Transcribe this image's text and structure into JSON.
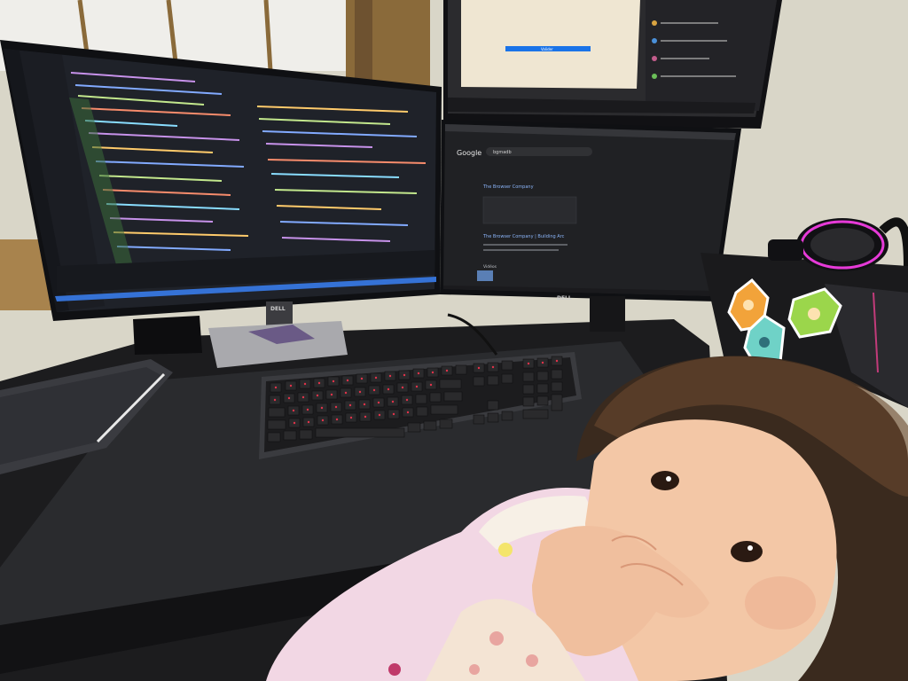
{
  "scene": {
    "colors": {
      "wall": "#d9d6c8",
      "desk": "#1c1c1e",
      "deskmat": "#2a2b2e",
      "editor_bg": "#1f2229",
      "browser_bg": "#202124",
      "keycap": "#2a2a2c",
      "key_legend": "#e0334a",
      "headset_ring": "#e63ad8"
    }
  },
  "monitor_left": {
    "brand": "DELL"
  },
  "monitor_right": {
    "brand": "DELL"
  },
  "browser": {
    "logo_text": "Google",
    "search_query": "bgmadb",
    "result_heading": "The Browser Company",
    "result_title_2": "The Browser Company | Building Arc",
    "video_label": "Vidéos"
  },
  "top_monitor": {
    "button_label": "Valider"
  }
}
